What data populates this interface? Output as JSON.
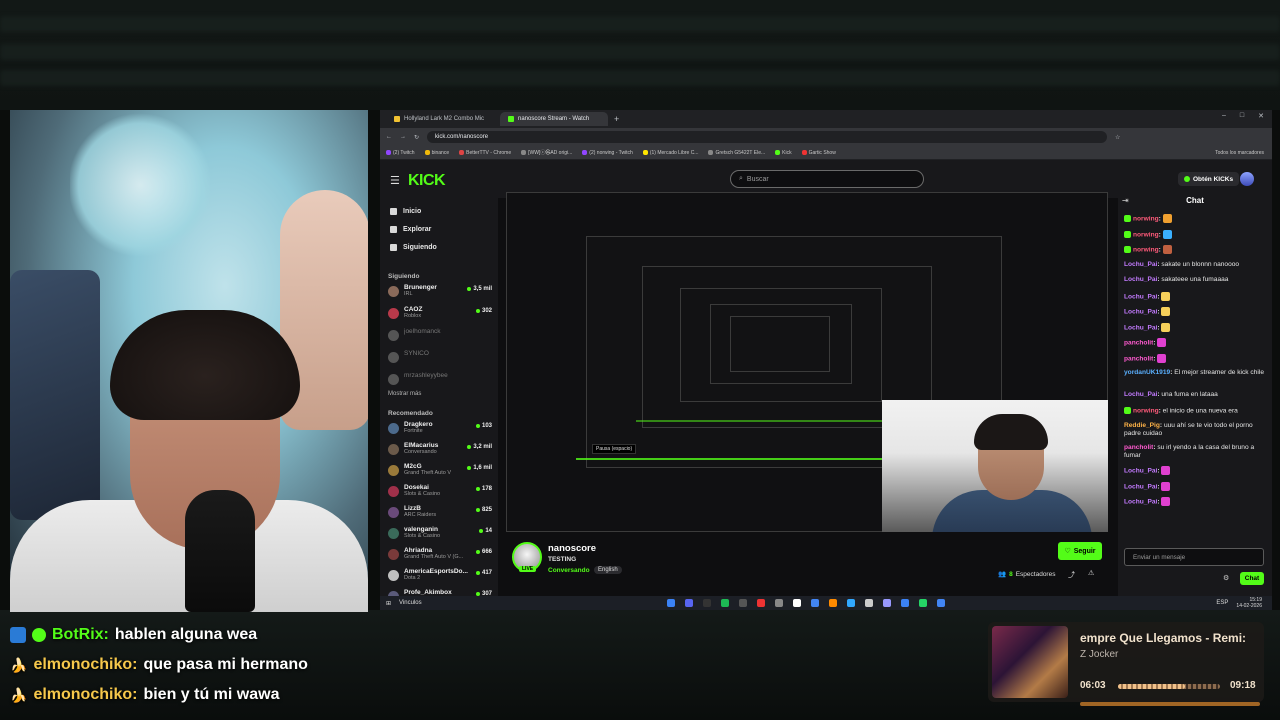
{
  "browser": {
    "tabs": [
      {
        "label": "Hollyland Lark M2 Combo Mic"
      },
      {
        "label": "nanoscore Stream - Watch"
      }
    ],
    "url": "kick.com/nanoscore",
    "bookmarks": [
      "(2) Twitch",
      "binance",
      "BetterTTV - Chrome",
      "[WW]ⓒ㉿AD origi...",
      "(2) norwing - Twitch",
      "(1) Mercado Libre C...",
      "Gretsch G5422T Ele...",
      "Kick",
      "Gartic Show",
      "Todos los marcadores"
    ]
  },
  "kick": {
    "logo": "KICK",
    "search_placeholder": "Buscar",
    "kicks_button": "Obtén KICKs",
    "nav": {
      "home": "Inicio",
      "explore": "Explorar",
      "following": "Siguiendo"
    },
    "following_header": "Siguiendo",
    "following": [
      {
        "name": "Brunenger",
        "category": "IRL",
        "viewers": "3,5 mil",
        "online": true,
        "color": "#8a6a5a"
      },
      {
        "name": "CAOZ",
        "category": "Roblox",
        "viewers": "302",
        "online": true,
        "color": "#b8394a"
      },
      {
        "name": "joelhomanck",
        "category": "",
        "viewers": "",
        "online": false,
        "color": "#555"
      },
      {
        "name": "SYNICO",
        "category": "",
        "viewers": "",
        "online": false,
        "color": "#555"
      },
      {
        "name": "mrzashleyybee",
        "category": "",
        "viewers": "",
        "online": false,
        "color": "#555"
      }
    ],
    "show_more_1": "Mostrar más",
    "recommended_header": "Recomendado",
    "recommended": [
      {
        "name": "Dragkero",
        "category": "Fortnite",
        "viewers": "103",
        "color": "#4c6a8c"
      },
      {
        "name": "ElMacarius",
        "category": "Conversando",
        "viewers": "3,2 mil",
        "color": "#6b5a4a"
      },
      {
        "name": "M2cG",
        "category": "Grand Theft Auto V",
        "viewers": "1,6 mil",
        "color": "#9a7a3a"
      },
      {
        "name": "Dosekai",
        "category": "Slots & Casino",
        "viewers": "178",
        "color": "#a0304a"
      },
      {
        "name": "LizzB",
        "category": "ARC Raiders",
        "viewers": "825",
        "color": "#6a4a7a"
      },
      {
        "name": "valenganin",
        "category": "Slots & Casino",
        "viewers": "14",
        "color": "#3a6a5a"
      },
      {
        "name": "Ahriadna",
        "category": "Grand Theft Auto V (G...",
        "viewers": "666",
        "color": "#7a3a3a"
      },
      {
        "name": "AmericaEsportsDo...",
        "category": "Dota 2",
        "viewers": "417",
        "color": "#c0c0c0"
      },
      {
        "name": "Profe_Akimbox",
        "category": "",
        "viewers": "307",
        "color": "#5a5a7a"
      }
    ],
    "stream": {
      "name": "nanoscore",
      "title": "TESTING",
      "category": "Conversando",
      "language": "English",
      "live": "LIVE",
      "follow": "Seguir",
      "viewers_count": "8",
      "viewers_label": "Espectadores",
      "tooltip": "Pausa (espacio)"
    },
    "chat": {
      "header": "Chat",
      "messages": [
        {
          "user": "norwing",
          "color": "#ff5a7a",
          "text": "",
          "badge": true,
          "emote": "#f0a030"
        },
        {
          "user": "norwing",
          "color": "#ff5a7a",
          "text": "",
          "badge": true,
          "emote": "#3ab0ff"
        },
        {
          "user": "norwing",
          "color": "#ff5a7a",
          "text": "",
          "badge": true,
          "emote": "#c06040"
        },
        {
          "user": "Lochu_Pai",
          "color": "#c37bff",
          "text": "sakate un blonnn nanoooo",
          "badge": false
        },
        {
          "user": "Lochu_Pai",
          "color": "#c37bff",
          "text": "sakateee una fumaaaa",
          "badge": false
        },
        {
          "user": "Lochu_Pai",
          "color": "#c37bff",
          "text": "",
          "badge": false,
          "emote": "#f6d05a"
        },
        {
          "user": "Lochu_Pai",
          "color": "#c37bff",
          "text": "",
          "badge": false,
          "emote": "#f6d05a"
        },
        {
          "user": "Lochu_Pai",
          "color": "#c37bff",
          "text": "",
          "badge": false,
          "emote": "#f6d05a"
        },
        {
          "user": "pancholit",
          "color": "#ff5ad0",
          "text": "",
          "badge": false,
          "emote": "#e040d0"
        },
        {
          "user": "pancholit",
          "color": "#ff5ad0",
          "text": "",
          "badge": false,
          "emote": "#e040d0"
        },
        {
          "user": "yordanUK1919",
          "color": "#5ab0ff",
          "text": "El mejor streamer de kick chile",
          "badge": false
        },
        {
          "user": "Lochu_Pai",
          "color": "#c37bff",
          "text": "una fuma en lataaa",
          "badge": false
        },
        {
          "user": "norwing",
          "color": "#ff5a7a",
          "text": "el inicio de una nueva era",
          "badge": true
        },
        {
          "user": "Reddie_Pig",
          "color": "#ffb347",
          "text": "uuu ahí se te vio todo el porno padre cuidao",
          "badge": false
        },
        {
          "user": "pancholit",
          "color": "#ff5ad0",
          "text": "su irl yendo a la casa del bruno a fumar",
          "badge": false
        },
        {
          "user": "Lochu_Pai",
          "color": "#c37bff",
          "text": "",
          "badge": false,
          "emote": "#e040d0"
        },
        {
          "user": "Lochu_Pai",
          "color": "#c37bff",
          "text": "",
          "badge": false,
          "emote": "#e040d0"
        },
        {
          "user": "Lochu_Pai",
          "color": "#c37bff",
          "text": "",
          "badge": false,
          "emote": "#e040d0"
        }
      ],
      "input_placeholder": "Enviar un mensaje",
      "send": "Chat"
    }
  },
  "taskbar": {
    "left_label": "Vinculos",
    "lang": "ESP",
    "time": "15:19",
    "date": "14-02-2026"
  },
  "overlay_chat": [
    {
      "user": "BotRix:",
      "text": "hablen alguna wea",
      "bot": true
    },
    {
      "user": "elmonochiko:",
      "text": "que pasa mi hermano",
      "bot": false
    },
    {
      "user": "elmonochiko:",
      "text": "bien y tú mi wawa",
      "bot": false
    }
  ],
  "now_playing": {
    "title": "empre Que Llegamos - Remi:",
    "artist": "Z Jocker",
    "current": "06:03",
    "end": "09:18",
    "progress": 0.66
  }
}
